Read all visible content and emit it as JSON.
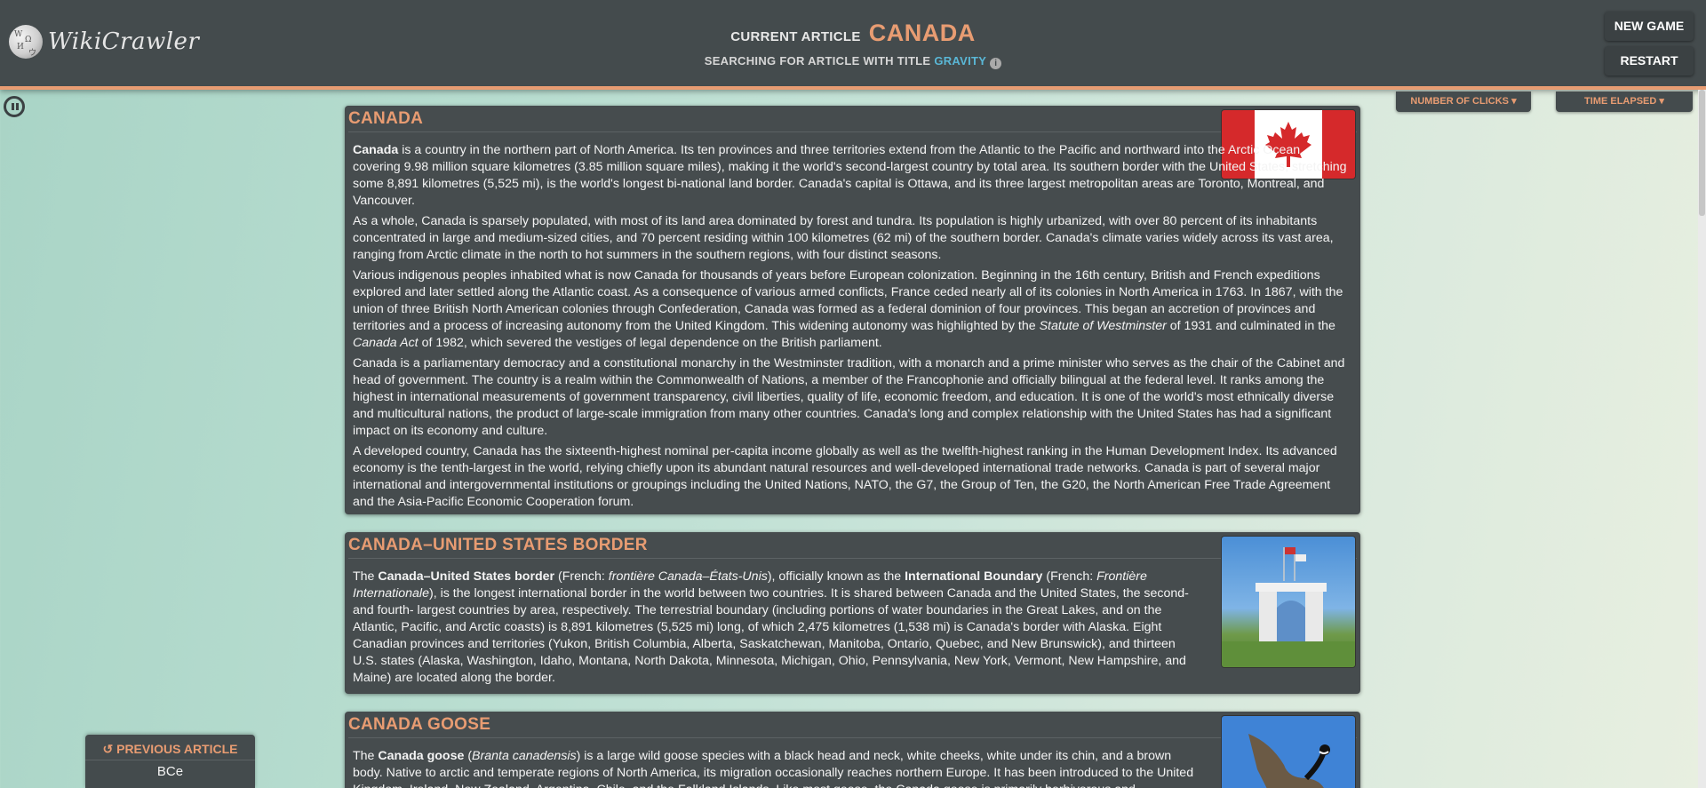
{
  "header": {
    "logo_text": "WikiCrawler",
    "current_label": "CURRENT ARTICLE",
    "current_title": "CANADA",
    "search_label": "SEARCHING FOR ARTICLE WITH TITLE",
    "target_title": "GRAVITY",
    "info_icon": "info-icon",
    "new_game_label": "NEW GAME",
    "restart_label": "RESTART"
  },
  "stats": {
    "clicks_label": "NUMBER OF CLICKS",
    "time_label": "TIME ELAPSED",
    "caret_icon": "caret-down-icon"
  },
  "controls": {
    "pause_icon": "pause-icon"
  },
  "articles": [
    {
      "title": "CANADA",
      "paragraphs": [
        [
          "",
          "Canada",
          " is a country in the northern part of North America. Its ten provinces and three territories extend from the Atlantic to the Pacific and northward into the Arctic Ocean, covering 9.98 million square kilometres (3.85 million square miles), making it the world's second-largest country by total area. Its southern border with the United States, stretching some 8,891 kilometres (5,525 mi), is the world's longest bi-national land border. Canada's capital is Ottawa, and its three largest metropolitan areas are Toronto, Montreal, and Vancouver."
        ],
        "As a whole, Canada is sparsely populated, with most of its land area dominated by forest and tundra. Its population is highly urbanized, with over 80 percent of its inhabitants concentrated in large and medium-sized cities, and 70 percent residing within 100 kilometres (62 mi) of the southern border. Canada's climate varies widely across its vast area, ranging from Arctic climate in the north to hot summers in the southern regions, with four distinct seasons.",
        [
          "Various indigenous peoples inhabited what is now Canada for thousands of years before European colonization. Beginning in the 16th century, British and French expeditions explored and later settled along the Atlantic coast. As a consequence of various armed conflicts, France ceded nearly all of its colonies in North America in 1763. In 1867, with the union of three British North American colonies through Confederation, Canada was formed as a federal dominion of four provinces. This began an accretion of provinces and territories and a process of increasing autonomy from the United Kingdom. This widening autonomy was highlighted by the ",
          "Statute of Westminster",
          " of 1931 and culminated in the ",
          "Canada Act",
          " of 1982, which severed the vestiges of legal dependence on the British parliament."
        ],
        "Canada is a parliamentary democracy and a constitutional monarchy in the Westminster tradition, with a monarch and a prime minister who serves as the chair of the Cabinet and head of government. The country is a realm within the Commonwealth of Nations, a member of the Francophonie and officially bilingual at the federal level. It ranks among the highest in international measurements of government transparency, civil liberties, quality of life, economic freedom, and education. It is one of the world's most ethnically diverse and multicultural nations, the product of large-scale immigration from many other countries. Canada's long and complex relationship with the United States has had a significant impact on its economy and culture.",
        "A developed country, Canada has the sixteenth-highest nominal per-capita income globally as well as the twelfth-highest ranking in the Human Development Index. Its advanced economy is the tenth-largest in the world, relying chiefly upon its abundant natural resources and well-developed international trade networks. Canada is part of several major international and intergovernmental institutions or groupings including the United Nations, NATO, the G7, the Group of Ten, the G20, the North American Free Trade Agreement and the Asia-Pacific Economic Cooperation forum."
      ]
    },
    {
      "title": "CANADA–UNITED STATES BORDER",
      "paragraphs": [
        [
          "The ",
          "Canada–United States border",
          " (French: ",
          "frontière Canada–États-Unis",
          "), officially known as the ",
          "International Boundary",
          " (French: ",
          "Frontière Internationale",
          "), is the longest international border in the world between two countries. It is shared between Canada and the United States, the second- and fourth- largest countries by area, respectively. The terrestrial boundary (including portions of water boundaries in the Great Lakes, and on the Atlantic, Pacific, and Arctic coasts) is 8,891 kilometres (5,525 mi) long, of which 2,475 kilometres (1,538 mi) is Canada's border with Alaska. Eight Canadian provinces and territories (Yukon, British Columbia, Alberta, Saskatchewan, Manitoba, Ontario, Quebec, and New Brunswick), and thirteen U.S. states (Alaska, Washington, Idaho, Montana, North Dakota, Minnesota, Michigan, Ohio, Pennsylvania, New York, Vermont, New Hampshire, and Maine) are located along the border."
        ]
      ]
    },
    {
      "title": "CANADA GOOSE",
      "paragraphs": [
        [
          "The ",
          "Canada goose",
          " (",
          "Branta canadensis",
          ") is a large wild goose species with a black head and neck, white cheeks, white under its chin, and a brown body. Native to arctic and temperate regions of North America, its migration occasionally reaches northern Europe. It has been introduced to the United Kingdom, Ireland, New Zealand, Argentina, Chile, and the Falkland Islands. Like most geese, the Canada goose is primarily herbivorous and"
        ]
      ]
    }
  ],
  "previous_article": {
    "label": "PREVIOUS ARTICLE",
    "value": "BCe",
    "icon": "undo-icon"
  },
  "colors": {
    "accent": "#e89c72",
    "panel": "#444b4d",
    "link": "#5ab7d6"
  }
}
